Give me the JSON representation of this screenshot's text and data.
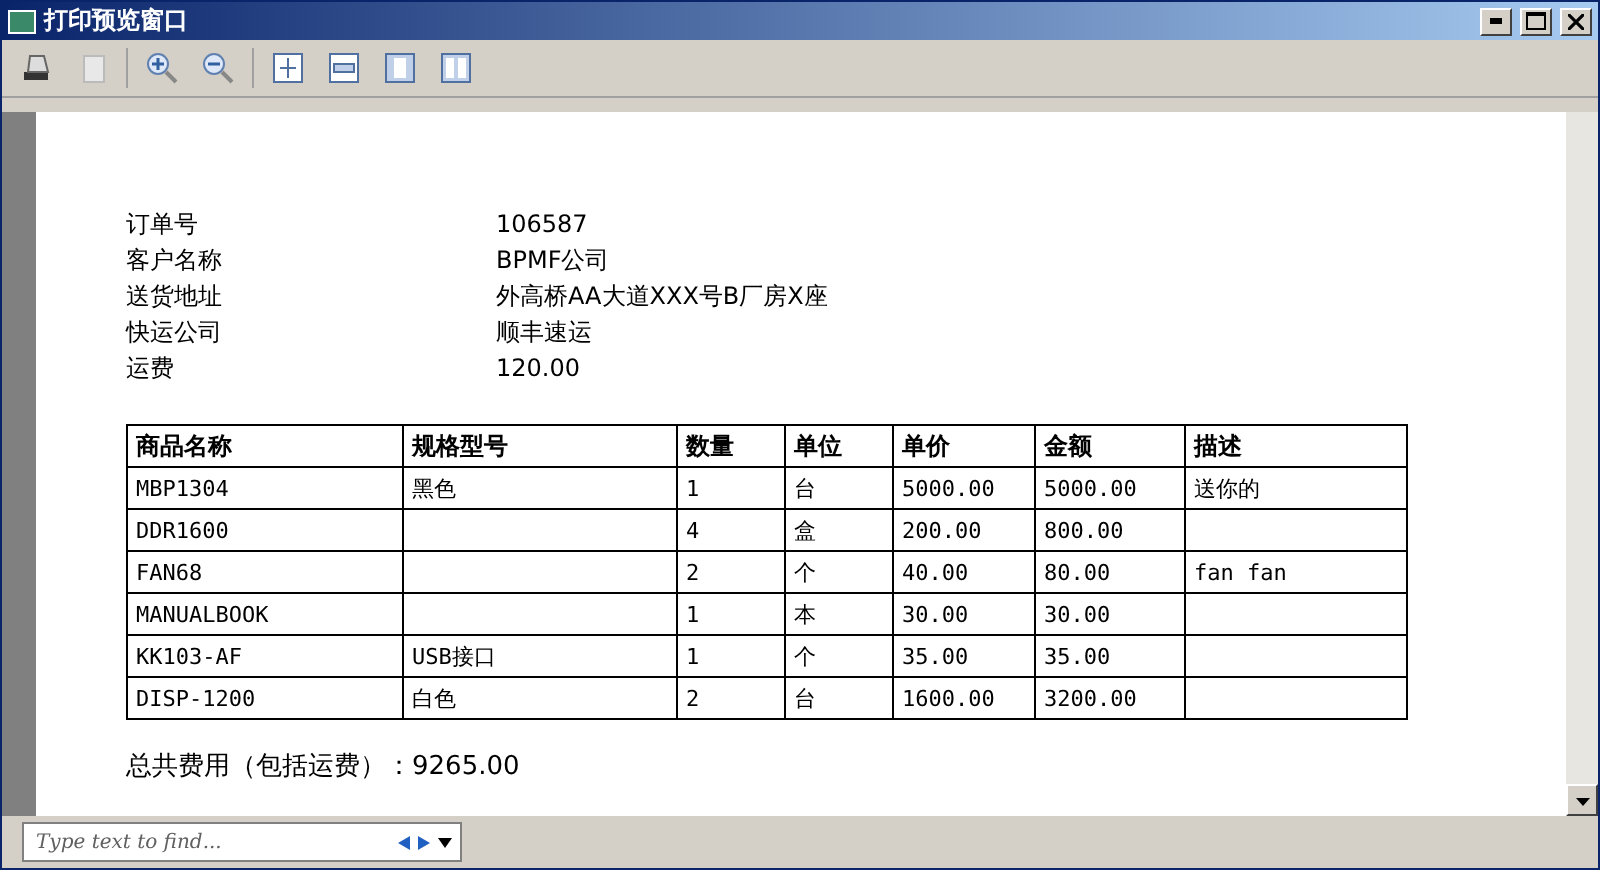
{
  "window": {
    "title": "打印预览窗口"
  },
  "info": [
    {
      "label": "订单号",
      "value": "106587"
    },
    {
      "label": "客户名称",
      "value": "BPMF公司"
    },
    {
      "label": "送货地址",
      "value": "外高桥AA大道XXX号B厂房X座"
    },
    {
      "label": "快运公司",
      "value": "顺丰速运"
    },
    {
      "label": "运费",
      "value": "120.00"
    }
  ],
  "table": {
    "columns": [
      "商品名称",
      "规格型号",
      "数量",
      "单位",
      "单价",
      "金额",
      "描述"
    ],
    "rows": [
      [
        "MBP1304",
        "黑色",
        "1",
        "台",
        "5000.00",
        "5000.00",
        "送你的"
      ],
      [
        "DDR1600",
        "",
        "4",
        "盒",
        "200.00",
        "800.00",
        ""
      ],
      [
        "FAN68",
        "",
        "2",
        "个",
        "40.00",
        "80.00",
        "fan fan"
      ],
      [
        "MANUALBOOK",
        "",
        "1",
        "本",
        "30.00",
        "30.00",
        ""
      ],
      [
        "KK103-AF",
        "USB接口",
        "1",
        "个",
        "35.00",
        "35.00",
        ""
      ],
      [
        "DISP-1200",
        "白色",
        "2",
        "台",
        "1600.00",
        "3200.00",
        ""
      ]
    ]
  },
  "total": "总共费用（包括运费）：9265.00",
  "find": {
    "placeholder": "Type text to find..."
  }
}
